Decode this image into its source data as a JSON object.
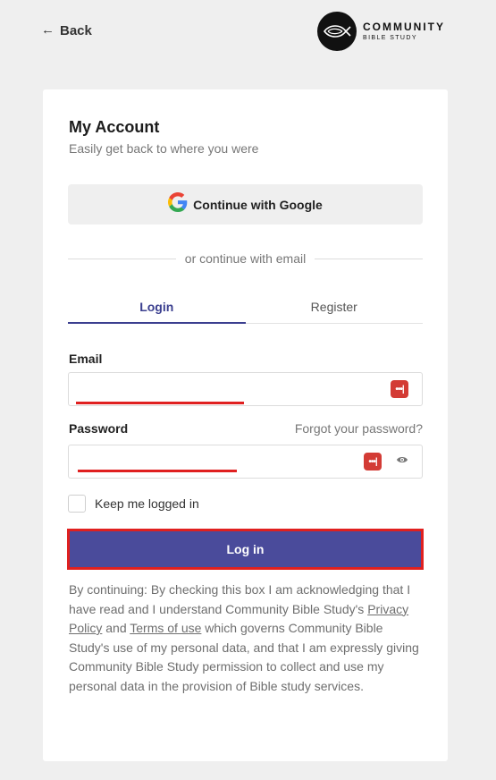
{
  "header": {
    "back_label": "Back",
    "logo_line1": "COMMUNITY",
    "logo_line2": "BIBLE STUDY"
  },
  "card": {
    "title": "My Account",
    "subtitle": "Easily get back to where you were",
    "google_label": "Continue with Google",
    "divider_text": "or continue with email",
    "tabs": [
      {
        "label": "Login",
        "active": true
      },
      {
        "label": "Register",
        "active": false
      }
    ],
    "email": {
      "label": "Email",
      "value": ""
    },
    "password": {
      "label": "Password",
      "value": "",
      "forgot_label": "Forgot your password?"
    },
    "keep_logged_in": {
      "label": "Keep me logged in",
      "checked": false
    },
    "login_button": "Log in",
    "legal": {
      "part1": "By continuing: By checking this box I am acknowledging that I have read and I understand Community Bible Study's ",
      "privacy_link": "Privacy Policy",
      "part2": " and ",
      "terms_link": "Terms of use",
      "part3": " which governs Community Bible Study's use of my personal data, and that I am expressly giving Community Bible Study permission to collect and use my personal data in the provision of Bible study services."
    }
  },
  "colors": {
    "accent": "#4a4b9b",
    "tab_active": "#3b3f8f",
    "highlight_red": "#e0201f",
    "password_manager_icon": "#d33b35",
    "background": "#efefef"
  }
}
